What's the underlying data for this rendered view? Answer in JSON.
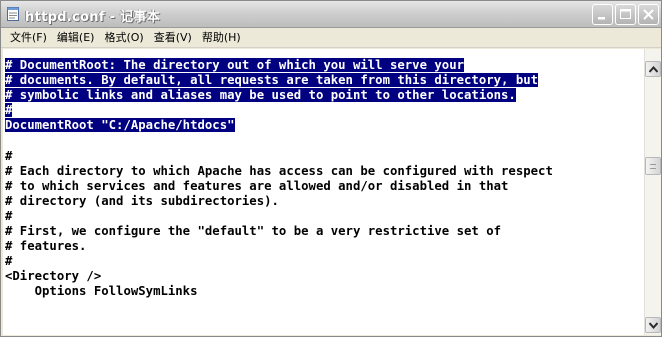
{
  "window": {
    "title": "httpd.conf - 记事本",
    "icon": "notepad-icon",
    "controls": [
      "minimize-icon",
      "maximize-icon",
      "close-icon"
    ]
  },
  "menu": {
    "items": [
      "文件(F)",
      "编辑(E)",
      "格式(O)",
      "查看(V)",
      "帮助(H)"
    ]
  },
  "editor": {
    "lines": [
      "# DocumentRoot: The directory out of which you will serve your",
      "# documents. By default, all requests are taken from this directory, but",
      "# symbolic links and aliases may be used to point to other locations.",
      "#",
      "DocumentRoot \"C:/Apache/htdocs\"",
      "",
      "#",
      "# Each directory to which Apache has access can be configured with respect",
      "# to which services and features are allowed and/or disabled in that",
      "# directory (and its subdirectories).",
      "#",
      "# First, we configure the \"default\" to be a very restrictive set of",
      "# features.",
      "#",
      "<Directory />",
      "    Options FollowSymLinks"
    ],
    "selected_line_count": 5,
    "selection_color": "#000080"
  },
  "scrollbar": {
    "up_icon": "arrow-up-icon",
    "down_icon": "arrow-down-icon"
  }
}
